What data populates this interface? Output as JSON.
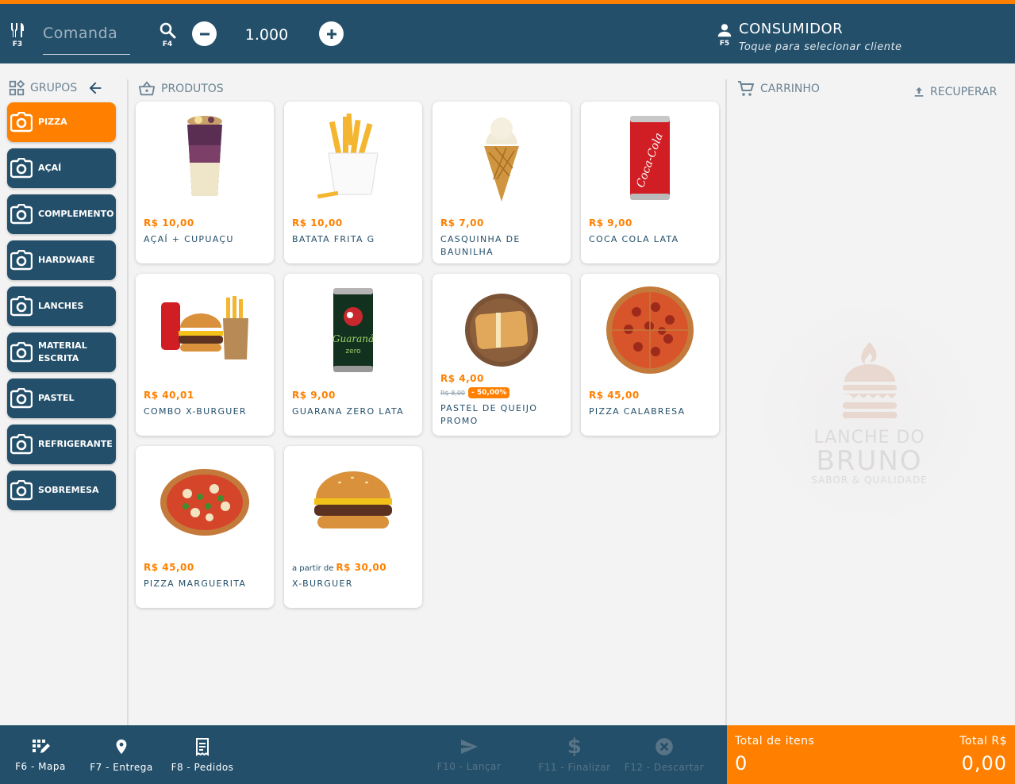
{
  "topbar": {
    "comanda_placeholder": "Comanda",
    "keys": {
      "f3": "F3",
      "f4": "F4",
      "f5": "F5"
    },
    "quantity": "1.000",
    "consumer_title": "CONSUMIDOR",
    "consumer_hint": "Toque para selecionar cliente"
  },
  "groups": {
    "title": "GRUPOS",
    "items": [
      {
        "label": "PIZZA",
        "active": true
      },
      {
        "label": "AÇAÍ"
      },
      {
        "label": "COMPLEMENTO"
      },
      {
        "label": "HARDWARE"
      },
      {
        "label": "LANCHES"
      },
      {
        "label": "MATERIAL ESCRITA"
      },
      {
        "label": "PASTEL"
      },
      {
        "label": "REFRIGERANTE"
      },
      {
        "label": "SOBREMESA"
      }
    ]
  },
  "products": {
    "title": "PRODUTOS",
    "items": [
      {
        "price": "R$ 10,00",
        "name": "AÇAÍ + CUPUAÇU",
        "icon": "acai-cup-icon"
      },
      {
        "price": "R$ 10,00",
        "name": "BATATA FRITA G",
        "icon": "fries-icon"
      },
      {
        "price": "R$ 7,00",
        "name": "CASQUINHA DE BAUNILHA",
        "icon": "ice-cream-cone-icon"
      },
      {
        "price": "R$ 9,00",
        "name": "COCA COLA LATA",
        "icon": "soda-can-red-icon"
      },
      {
        "price": "R$ 40,01",
        "name": "COMBO X-BURGUER",
        "icon": "combo-burger-icon"
      },
      {
        "price": "R$ 9,00",
        "name": "GUARANA ZERO LATA",
        "icon": "soda-can-green-icon"
      },
      {
        "price": "R$ 4,00",
        "old_price": "R$ 8,00",
        "discount": "- 50,00%",
        "name": "PASTEL DE QUEIJO PROMO",
        "icon": "pastel-icon"
      },
      {
        "price": "R$ 45,00",
        "name": "PIZZA CALABRESA",
        "icon": "pizza-pepperoni-icon"
      },
      {
        "price": "R$ 45,00",
        "name": "PIZZA MARGUERITA",
        "icon": "pizza-margherita-icon"
      },
      {
        "prefix": "a partir de",
        "price": "R$ 30,00",
        "name": "X-BURGUER",
        "icon": "burger-icon"
      }
    ]
  },
  "cart": {
    "title": "CARRINHO",
    "recover_label": "RECUPERAR",
    "logo_line1": "LANCHE DO",
    "logo_line2": "BRUNO",
    "logo_tagline": "SABOR & QUALIDADE"
  },
  "bottombar": {
    "buttons": [
      {
        "label": "F6 - Mapa",
        "enabled": true
      },
      {
        "label": "F7 - Entrega",
        "enabled": true
      },
      {
        "label": "F8 - Pedidos",
        "enabled": true
      },
      {
        "label": "F10 - Lançar",
        "enabled": false
      },
      {
        "label": "F11 - Finalizar",
        "enabled": false
      },
      {
        "label": "F12 - Descartar",
        "enabled": false
      }
    ]
  },
  "totals": {
    "items_label": "Total de itens",
    "items_value": "0",
    "amount_label": "Total R$",
    "amount_value": "0,00"
  },
  "colors": {
    "primary": "#234f6a",
    "accent": "#ff8000",
    "background": "#f3f3f3"
  }
}
